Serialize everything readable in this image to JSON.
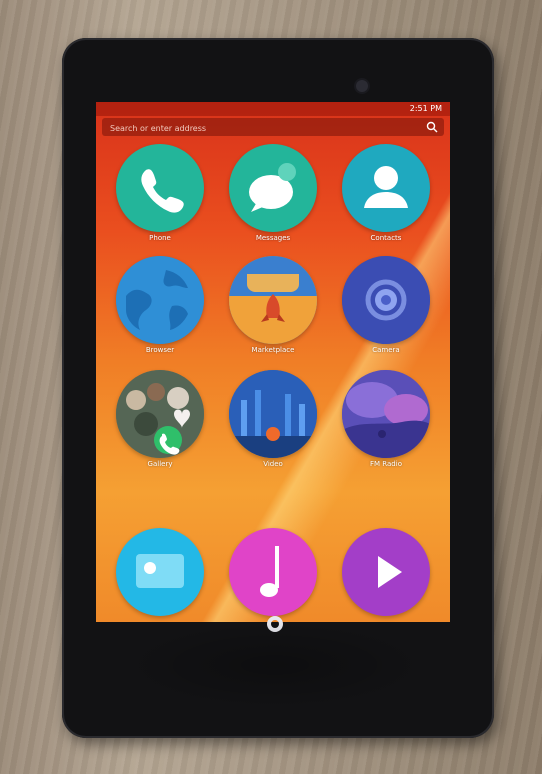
{
  "search": {
    "placeholder": "Search or enter address"
  },
  "status": {
    "time": "2:51 PM"
  },
  "apps": [
    {
      "label": "Phone",
      "icon": "phone-icon",
      "color": "#23b59a"
    },
    {
      "label": "Messages",
      "icon": "messages-icon",
      "color": "#23b59a"
    },
    {
      "label": "Contacts",
      "icon": "contacts-icon",
      "color": "#1fa9bf"
    },
    {
      "label": "Browser",
      "icon": "browser-icon",
      "color": "#2f8fd6"
    },
    {
      "label": "Marketplace",
      "icon": "marketplace-icon",
      "color": "#d85a24"
    },
    {
      "label": "Camera",
      "icon": "camera-icon",
      "color": "#3b4db3"
    },
    {
      "label": "Gallery",
      "icon": "gallery-icon",
      "color": "#6a7a6a"
    },
    {
      "label": "Video",
      "icon": "video-icon",
      "color": "#2566c4"
    },
    {
      "label": "FM Radio",
      "icon": "radio-icon",
      "color": "#6a5fc0"
    },
    {
      "label": "",
      "icon": "card-icon",
      "color": "#23b8e6"
    },
    {
      "label": "",
      "icon": "music-icon",
      "color": "#e044c8"
    },
    {
      "label": "",
      "icon": "play-icon",
      "color": "#a33ec8"
    }
  ]
}
